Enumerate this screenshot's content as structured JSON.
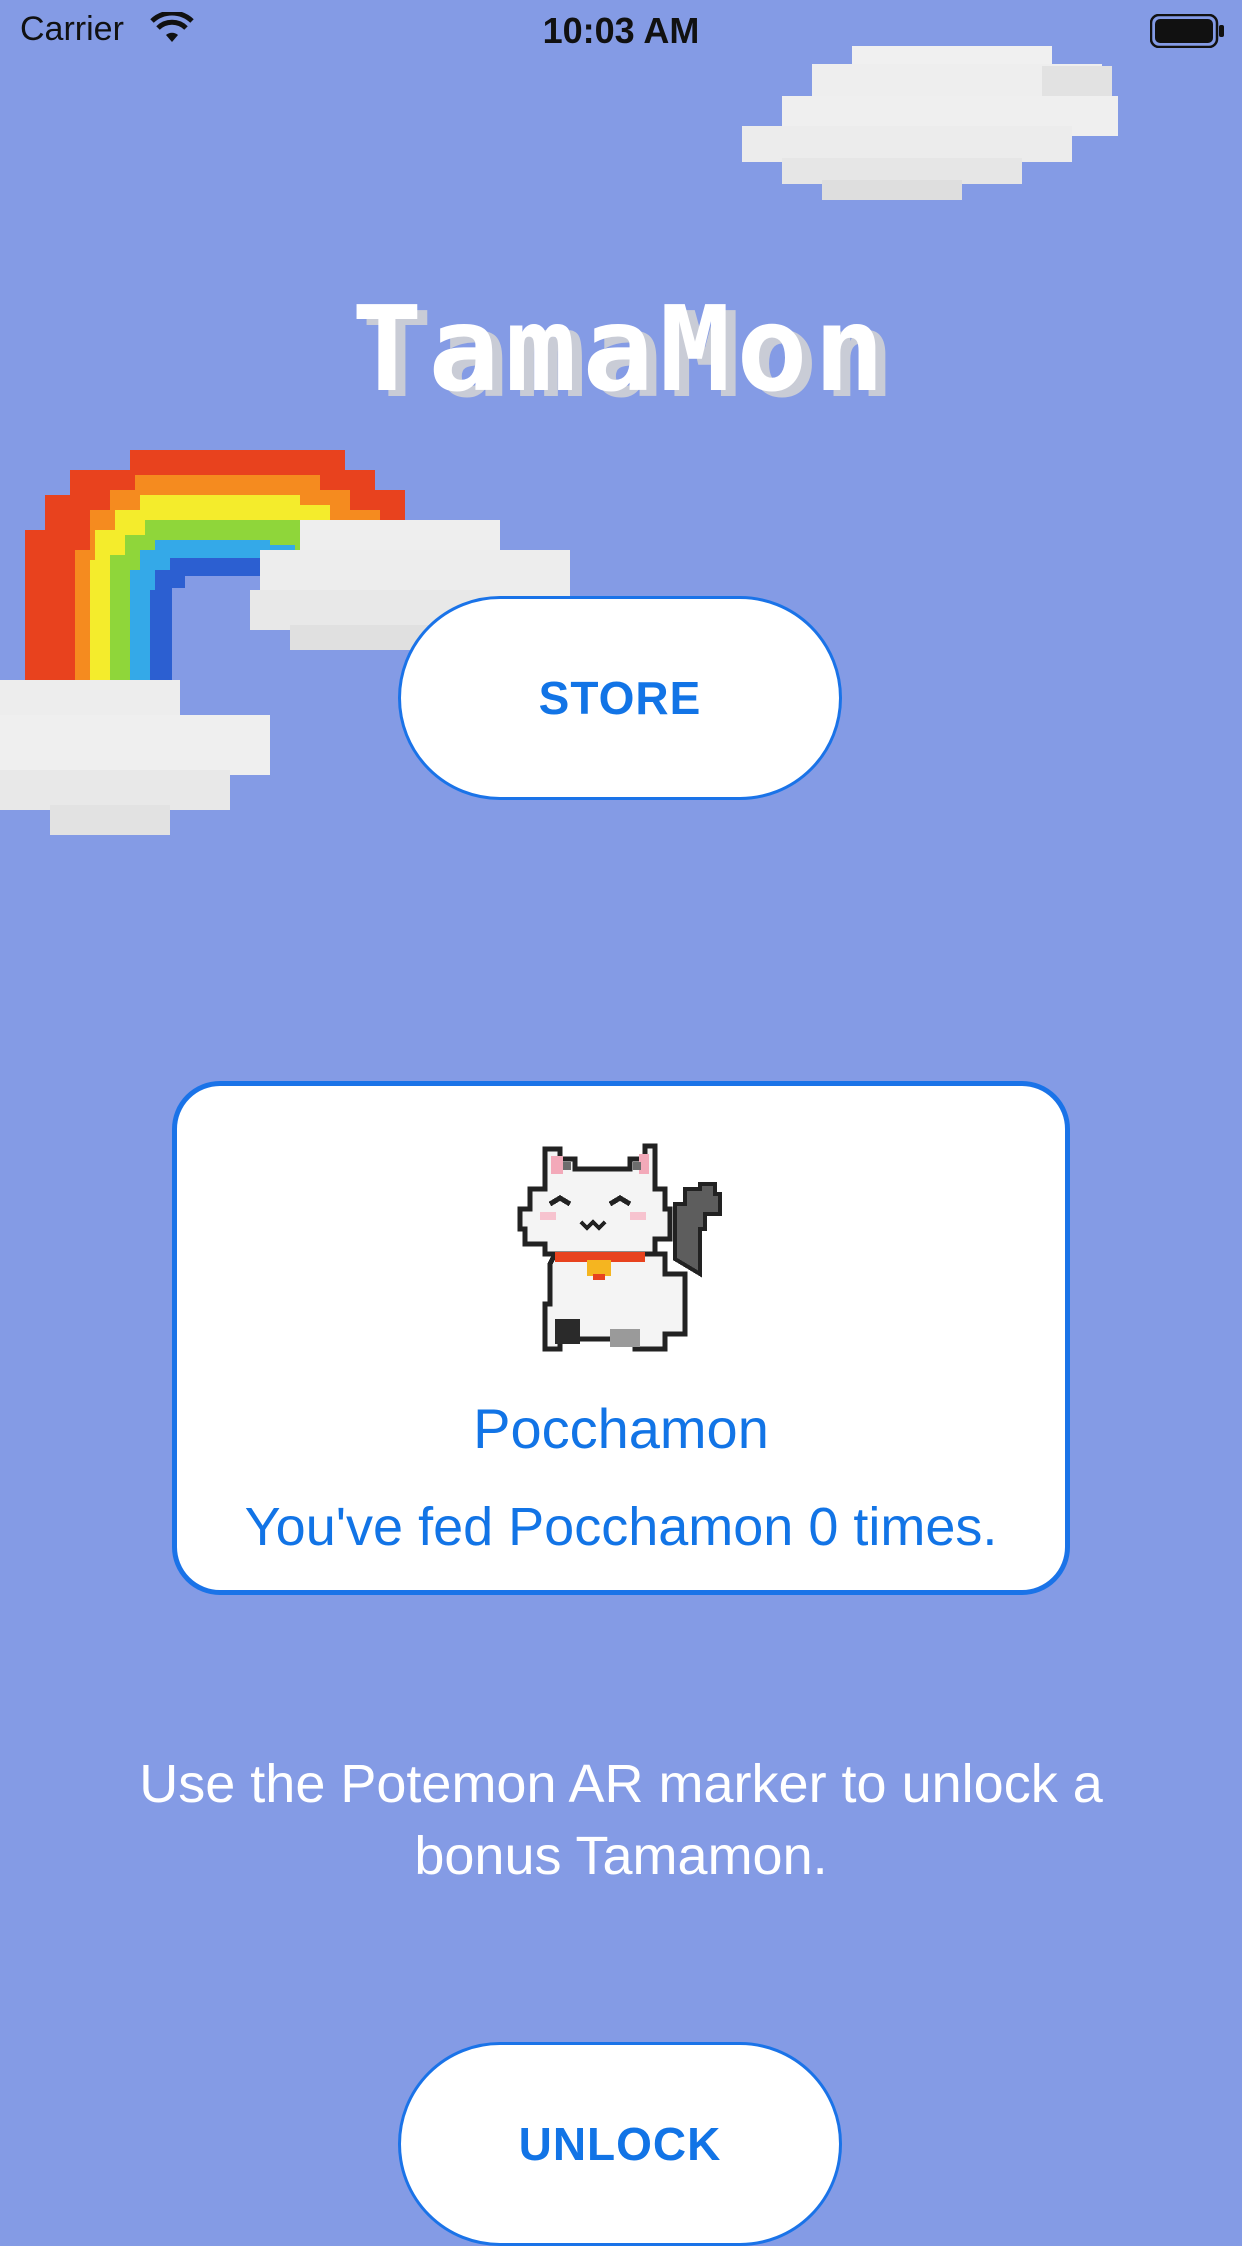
{
  "status_bar": {
    "carrier": "Carrier",
    "time": "10:03 AM"
  },
  "app": {
    "title": "TamaMon"
  },
  "store_button": {
    "label": "STORE"
  },
  "pet_card": {
    "name": "Pocchamon",
    "fed_message": "You've fed Pocchamon 0 times."
  },
  "unlock_info": {
    "text": "Use the Potemon AR marker to unlock a bonus Tamamon."
  },
  "unlock_button": {
    "label": "UNLOCK"
  },
  "colors": {
    "background": "#849be5",
    "accent": "#1274e6",
    "card_border": "#1a73e8",
    "cloud": "#eeeeee"
  },
  "icons": [
    "wifi-icon",
    "battery-icon",
    "cloud-image",
    "rainbow-image",
    "cat-image"
  ]
}
